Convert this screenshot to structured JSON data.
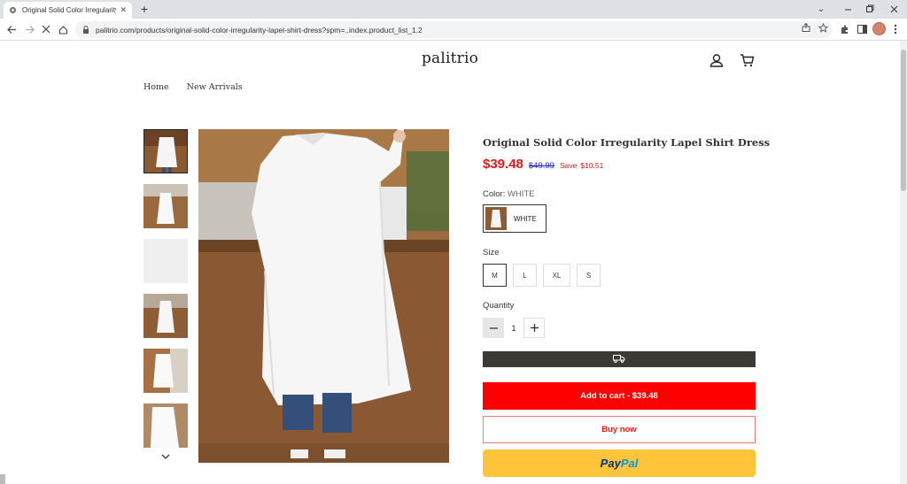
{
  "browser": {
    "tab_title": "Original Solid Color Irregularity Lapel Shirt Dress",
    "tab_close": "✕",
    "new_tab": "+",
    "url": "palitrio.com/products/original-solid-color-irregularity-lapel-shirt-dress?spm=..index.product_list_1.2"
  },
  "store": {
    "logo": "palitrio",
    "nav": [
      "Home",
      "New Arrivals"
    ]
  },
  "product": {
    "title": "Original Solid Color Irregularity Lapel Shirt Dress",
    "price": "$39.48",
    "compare_price": "$49.99",
    "save_label": "Save",
    "save_amount": "$10.51",
    "color_label": "Color:",
    "color_value": "WHITE",
    "colors": [
      "WHITE"
    ],
    "size_label": "Size",
    "sizes": [
      "M",
      "L",
      "XL",
      "S"
    ],
    "selected_size": "M",
    "quantity_label": "Quantity",
    "quantity": "1",
    "add_to_cart": "Add to cart - $39.48",
    "buy_now": "Buy now",
    "paypal_a": "Pay",
    "paypal_b": "Pal",
    "thumbnail_count": 6,
    "active_thumbnail": 0
  },
  "colors": {
    "accent_red": "#ff0000",
    "price_red": "#e51919",
    "compare_blue": "#1a1ae6",
    "shipping_bar": "#3d3a36",
    "paypal_yellow": "#ffc439"
  }
}
